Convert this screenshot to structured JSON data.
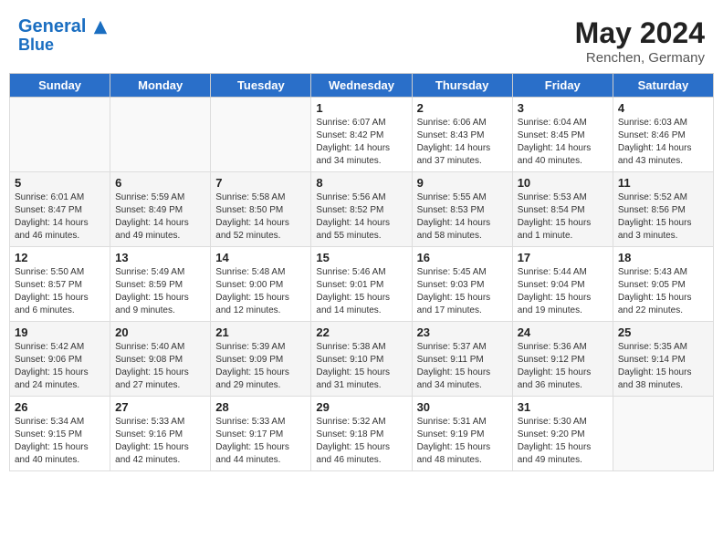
{
  "header": {
    "logo_line1": "General",
    "logo_line2": "Blue",
    "month_year": "May 2024",
    "location": "Renchen, Germany"
  },
  "weekdays": [
    "Sunday",
    "Monday",
    "Tuesday",
    "Wednesday",
    "Thursday",
    "Friday",
    "Saturday"
  ],
  "weeks": [
    [
      {
        "day": "",
        "info": ""
      },
      {
        "day": "",
        "info": ""
      },
      {
        "day": "",
        "info": ""
      },
      {
        "day": "1",
        "info": "Sunrise: 6:07 AM\nSunset: 8:42 PM\nDaylight: 14 hours\nand 34 minutes."
      },
      {
        "day": "2",
        "info": "Sunrise: 6:06 AM\nSunset: 8:43 PM\nDaylight: 14 hours\nand 37 minutes."
      },
      {
        "day": "3",
        "info": "Sunrise: 6:04 AM\nSunset: 8:45 PM\nDaylight: 14 hours\nand 40 minutes."
      },
      {
        "day": "4",
        "info": "Sunrise: 6:03 AM\nSunset: 8:46 PM\nDaylight: 14 hours\nand 43 minutes."
      }
    ],
    [
      {
        "day": "5",
        "info": "Sunrise: 6:01 AM\nSunset: 8:47 PM\nDaylight: 14 hours\nand 46 minutes."
      },
      {
        "day": "6",
        "info": "Sunrise: 5:59 AM\nSunset: 8:49 PM\nDaylight: 14 hours\nand 49 minutes."
      },
      {
        "day": "7",
        "info": "Sunrise: 5:58 AM\nSunset: 8:50 PM\nDaylight: 14 hours\nand 52 minutes."
      },
      {
        "day": "8",
        "info": "Sunrise: 5:56 AM\nSunset: 8:52 PM\nDaylight: 14 hours\nand 55 minutes."
      },
      {
        "day": "9",
        "info": "Sunrise: 5:55 AM\nSunset: 8:53 PM\nDaylight: 14 hours\nand 58 minutes."
      },
      {
        "day": "10",
        "info": "Sunrise: 5:53 AM\nSunset: 8:54 PM\nDaylight: 15 hours\nand 1 minute."
      },
      {
        "day": "11",
        "info": "Sunrise: 5:52 AM\nSunset: 8:56 PM\nDaylight: 15 hours\nand 3 minutes."
      }
    ],
    [
      {
        "day": "12",
        "info": "Sunrise: 5:50 AM\nSunset: 8:57 PM\nDaylight: 15 hours\nand 6 minutes."
      },
      {
        "day": "13",
        "info": "Sunrise: 5:49 AM\nSunset: 8:59 PM\nDaylight: 15 hours\nand 9 minutes."
      },
      {
        "day": "14",
        "info": "Sunrise: 5:48 AM\nSunset: 9:00 PM\nDaylight: 15 hours\nand 12 minutes."
      },
      {
        "day": "15",
        "info": "Sunrise: 5:46 AM\nSunset: 9:01 PM\nDaylight: 15 hours\nand 14 minutes."
      },
      {
        "day": "16",
        "info": "Sunrise: 5:45 AM\nSunset: 9:03 PM\nDaylight: 15 hours\nand 17 minutes."
      },
      {
        "day": "17",
        "info": "Sunrise: 5:44 AM\nSunset: 9:04 PM\nDaylight: 15 hours\nand 19 minutes."
      },
      {
        "day": "18",
        "info": "Sunrise: 5:43 AM\nSunset: 9:05 PM\nDaylight: 15 hours\nand 22 minutes."
      }
    ],
    [
      {
        "day": "19",
        "info": "Sunrise: 5:42 AM\nSunset: 9:06 PM\nDaylight: 15 hours\nand 24 minutes."
      },
      {
        "day": "20",
        "info": "Sunrise: 5:40 AM\nSunset: 9:08 PM\nDaylight: 15 hours\nand 27 minutes."
      },
      {
        "day": "21",
        "info": "Sunrise: 5:39 AM\nSunset: 9:09 PM\nDaylight: 15 hours\nand 29 minutes."
      },
      {
        "day": "22",
        "info": "Sunrise: 5:38 AM\nSunset: 9:10 PM\nDaylight: 15 hours\nand 31 minutes."
      },
      {
        "day": "23",
        "info": "Sunrise: 5:37 AM\nSunset: 9:11 PM\nDaylight: 15 hours\nand 34 minutes."
      },
      {
        "day": "24",
        "info": "Sunrise: 5:36 AM\nSunset: 9:12 PM\nDaylight: 15 hours\nand 36 minutes."
      },
      {
        "day": "25",
        "info": "Sunrise: 5:35 AM\nSunset: 9:14 PM\nDaylight: 15 hours\nand 38 minutes."
      }
    ],
    [
      {
        "day": "26",
        "info": "Sunrise: 5:34 AM\nSunset: 9:15 PM\nDaylight: 15 hours\nand 40 minutes."
      },
      {
        "day": "27",
        "info": "Sunrise: 5:33 AM\nSunset: 9:16 PM\nDaylight: 15 hours\nand 42 minutes."
      },
      {
        "day": "28",
        "info": "Sunrise: 5:33 AM\nSunset: 9:17 PM\nDaylight: 15 hours\nand 44 minutes."
      },
      {
        "day": "29",
        "info": "Sunrise: 5:32 AM\nSunset: 9:18 PM\nDaylight: 15 hours\nand 46 minutes."
      },
      {
        "day": "30",
        "info": "Sunrise: 5:31 AM\nSunset: 9:19 PM\nDaylight: 15 hours\nand 48 minutes."
      },
      {
        "day": "31",
        "info": "Sunrise: 5:30 AM\nSunset: 9:20 PM\nDaylight: 15 hours\nand 49 minutes."
      },
      {
        "day": "",
        "info": ""
      }
    ]
  ]
}
